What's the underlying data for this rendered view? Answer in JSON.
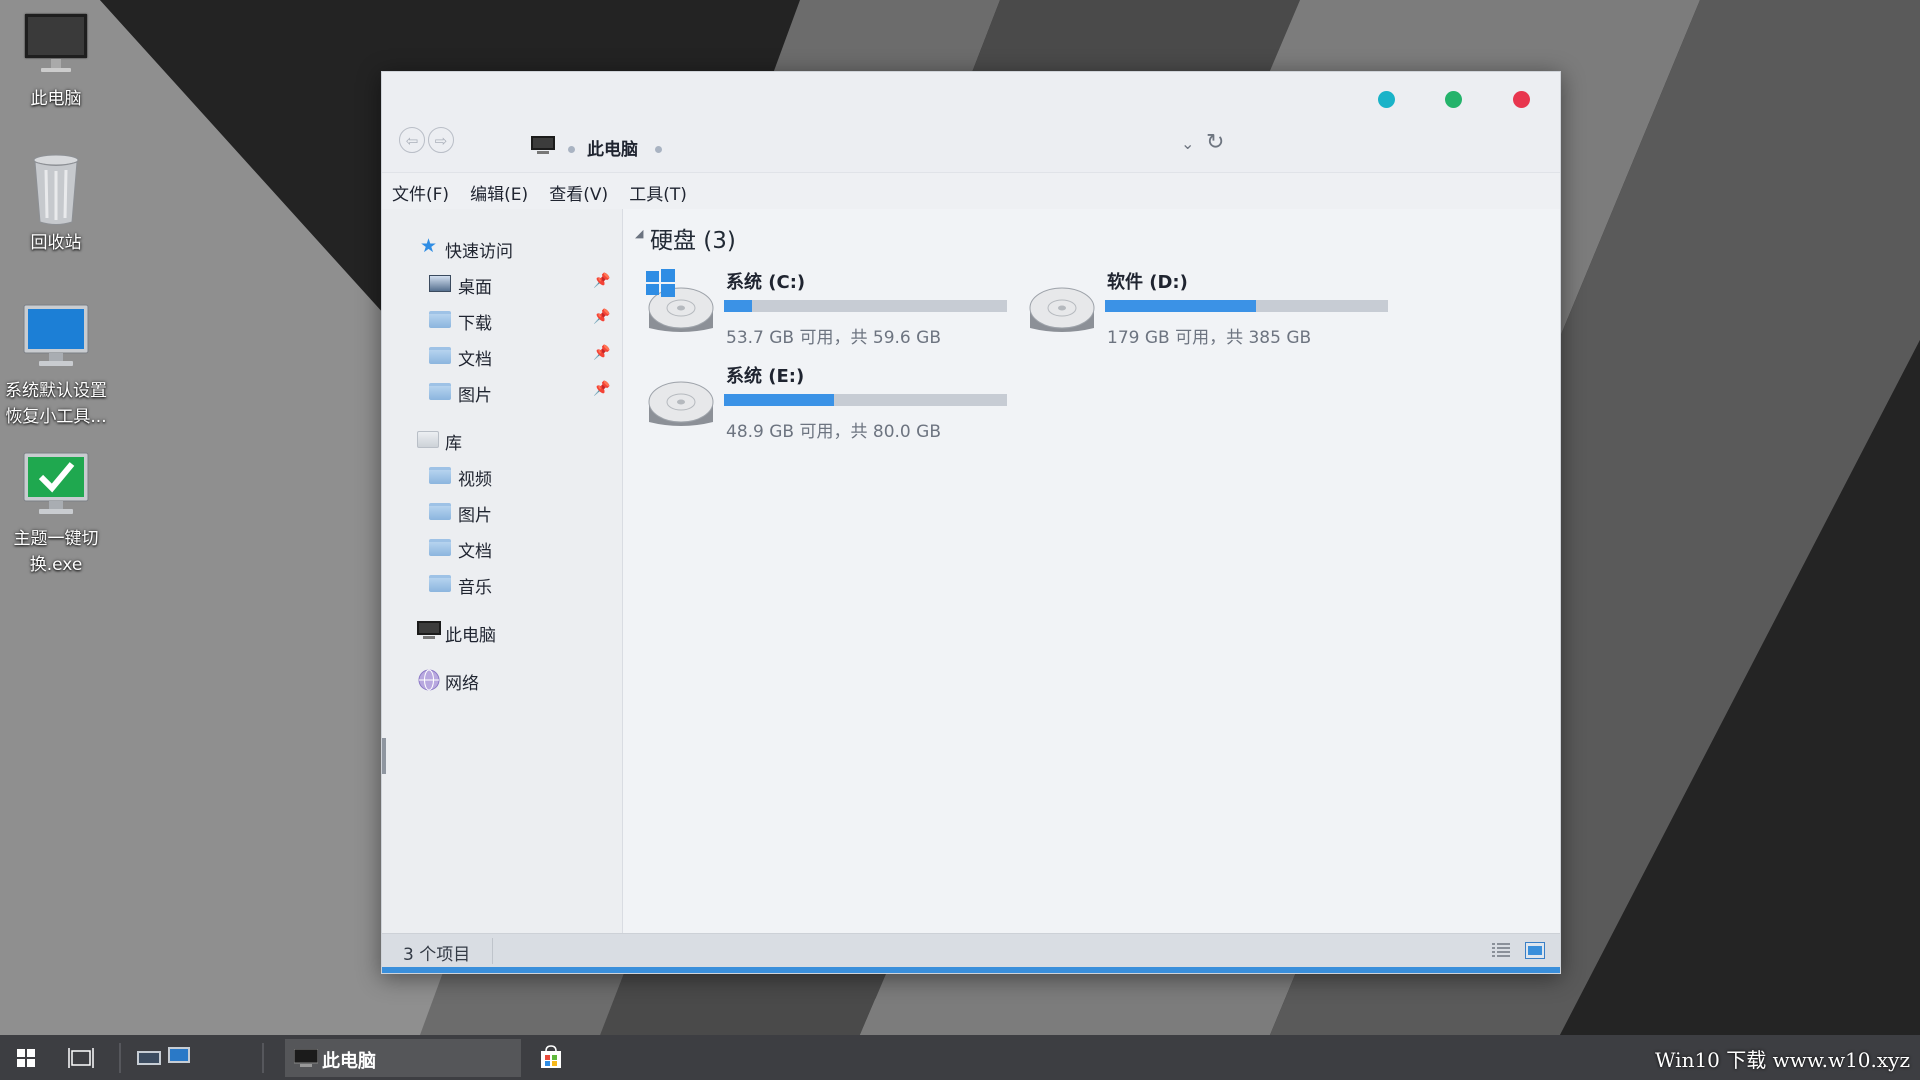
{
  "desktop": {
    "icons": [
      {
        "label": "此电脑"
      },
      {
        "label": "回收站"
      },
      {
        "label_line1": "系统默认设置",
        "label_line2": "恢复小工具..."
      },
      {
        "label_line1": "主题一键切",
        "label_line2": "换.exe"
      }
    ]
  },
  "window": {
    "control_colors": {
      "dot1": "#1ab3c8",
      "dot2": "#24b36b",
      "dot3": "#e8364f"
    },
    "address": {
      "location": "此电脑",
      "nav_back": "⇦",
      "nav_forward": "⇨",
      "chevron": "⌄",
      "refresh": "↻"
    },
    "menu": [
      "文件(F)",
      "编辑(E)",
      "查看(V)",
      "工具(T)"
    ],
    "nav": {
      "quick_access": "快速访问",
      "quick_items": [
        "桌面",
        "下载",
        "文档",
        "图片"
      ],
      "pin_glyph": "📌",
      "library": "库",
      "library_items": [
        "视频",
        "图片",
        "文档",
        "音乐"
      ],
      "this_pc": "此电脑",
      "network": "网络"
    },
    "content": {
      "group_title": "硬盘 (3)",
      "drives": [
        {
          "name": "系统 (C:)",
          "info": "53.7 GB 可用，共 59.6 GB",
          "used_fraction": 0.1
        },
        {
          "name": "软件 (D:)",
          "info": "179 GB 可用，共 385 GB",
          "used_fraction": 0.535
        },
        {
          "name": "系统 (E:)",
          "info": "48.9 GB 可用，共 80.0 GB",
          "used_fraction": 0.39
        }
      ]
    },
    "status": {
      "item_count": "3 个项目"
    }
  },
  "taskbar": {
    "active_task": "此电脑",
    "watermark": "Win10 下载 www.w10.xyz"
  }
}
